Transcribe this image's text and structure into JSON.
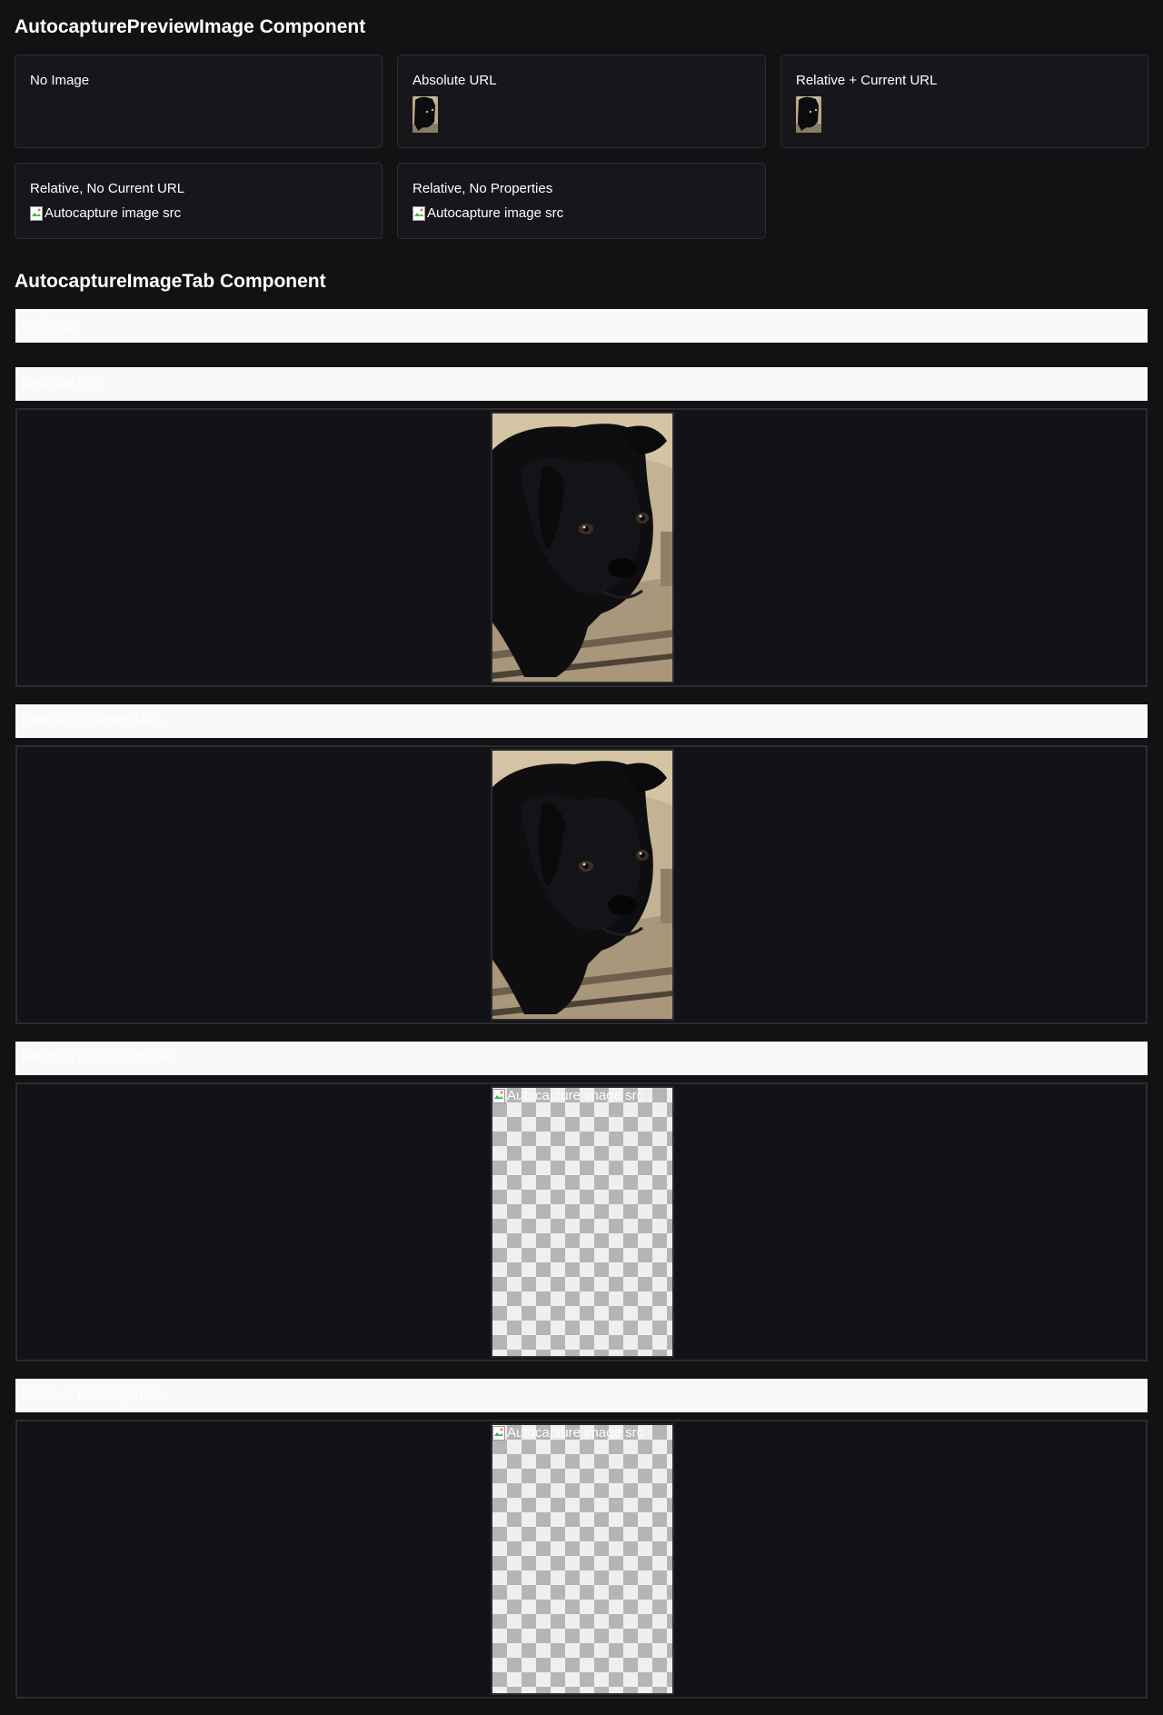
{
  "preview_section": {
    "title": "AutocapturePreviewImage Component",
    "cards": [
      {
        "title": "No Image",
        "kind": "none"
      },
      {
        "title": "Absolute URL",
        "kind": "thumb"
      },
      {
        "title": "Relative + Current URL",
        "kind": "thumb"
      },
      {
        "title": "Relative, No Current URL",
        "kind": "broken",
        "alt": "Autocapture image src"
      },
      {
        "title": "Relative, No Properties",
        "kind": "broken",
        "alt": "Autocapture image src"
      }
    ]
  },
  "tab_section": {
    "title": "AutocaptureImageTab Component",
    "tabs": [
      {
        "label": "No image",
        "kind": "none"
      },
      {
        "label": "Absolute URL",
        "kind": "image"
      },
      {
        "label": "Relative + Current URL",
        "kind": "image"
      },
      {
        "label": "Relative, No Current URL",
        "kind": "broken",
        "alt": "Autocapture image src"
      },
      {
        "label": "Relative, No Properties",
        "kind": "broken",
        "alt": "Autocapture image src"
      }
    ]
  },
  "icons": {
    "broken_image": "broken-image-icon",
    "dog_photo": "dog-photo-image"
  },
  "colors": {
    "background": "#121215",
    "card_border": "#2d2d33",
    "tab_header": "#f8f9fb"
  }
}
